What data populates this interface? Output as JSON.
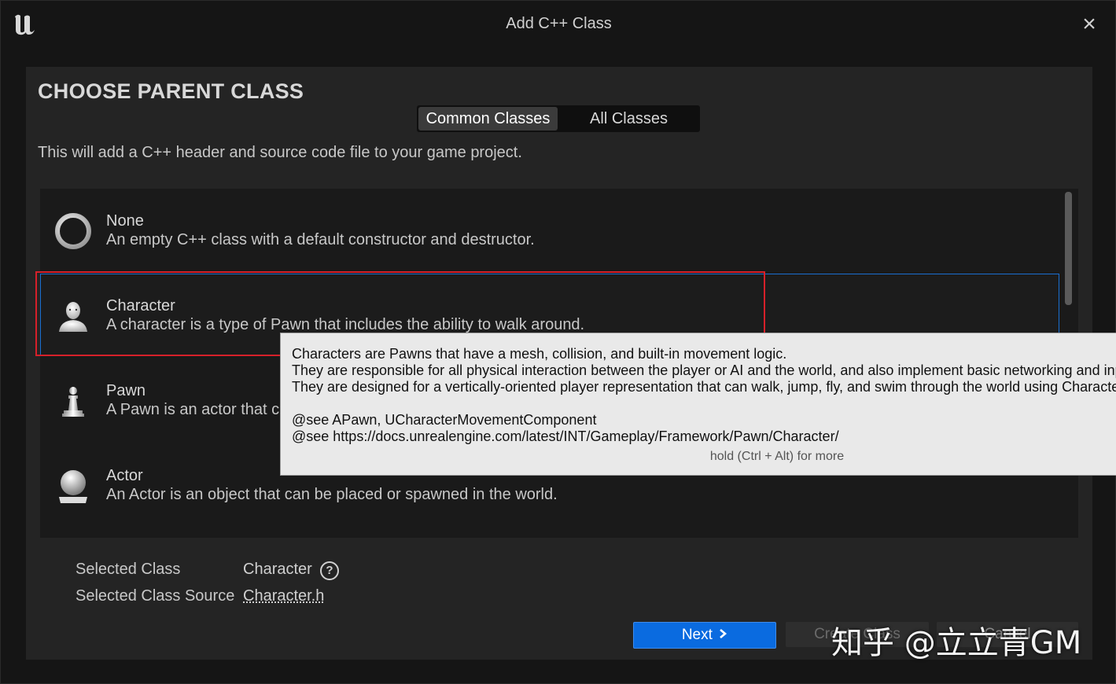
{
  "window": {
    "title": "Add C++ Class",
    "logo_icon": "unreal-logo",
    "close_icon": "close-icon",
    "close_glyph": "×"
  },
  "header": {
    "heading": "CHOOSE PARENT CLASS",
    "description": "This will add a C++ header and source code file to your game project."
  },
  "tabs": [
    {
      "label": "Common Classes",
      "active": true
    },
    {
      "label": "All Classes",
      "active": false
    }
  ],
  "class_list": [
    {
      "name": "None",
      "description": "An empty C++ class with a default constructor and destructor.",
      "icon": "empty-ring-icon"
    },
    {
      "name": "Character",
      "description": "A character is a type of Pawn that includes the ability to walk around.",
      "icon": "character-bust-icon"
    },
    {
      "name": "Pawn",
      "description": "A Pawn is an actor that c",
      "icon": "pawn-chess-icon"
    },
    {
      "name": "Actor",
      "description": "An Actor is an object that can be placed or spawned in the world.",
      "icon": "sphere-icon"
    }
  ],
  "tooltip": {
    "lines": [
      "Characters are Pawns that have a mesh, collision, and built-in movement logic.",
      "They are responsible for all physical interaction between the player or AI and the world, and also implement basic networking and inp",
      "They are designed for a vertically-oriented player representation that can walk, jump, fly, and swim through the world using Characte",
      "",
      "@see APawn, UCharacterMovementComponent",
      "@see https://docs.unrealengine.com/latest/INT/Gameplay/Framework/Pawn/Character/"
    ],
    "more_hint": "hold (Ctrl + Alt) for more"
  },
  "selection": {
    "class_label": "Selected Class",
    "class_value": "Character",
    "source_label": "Selected Class Source",
    "source_value": "Character.h",
    "help_glyph": "?"
  },
  "buttons": {
    "next": "Next",
    "next_icon": "chevron-right-icon",
    "create": "Create Class",
    "cancel": "Cancel"
  },
  "watermark": "知乎 @立立青GM",
  "colors": {
    "accent": "#0a6be0",
    "selection_border": "#1a6fd1",
    "highlight_red": "#d6202a"
  }
}
